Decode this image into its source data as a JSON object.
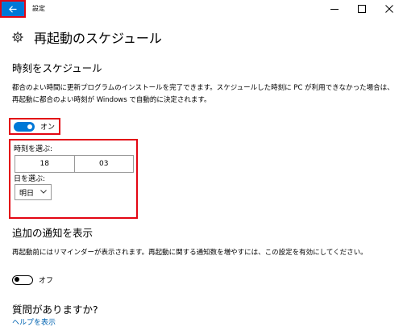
{
  "titlebar": {
    "app_title": "設定",
    "back_icon": "back-arrow-icon",
    "controls": [
      "minimize-icon",
      "maximize-icon",
      "close-icon"
    ]
  },
  "page": {
    "title": "再起動のスケジュール",
    "icon": "gear-icon"
  },
  "schedule": {
    "section_title": "時刻をスケジュール",
    "description": "都合のよい時間に更新プログラムのインストールを完了できます。スケジュールした時刻に PC が利用できなかった場合は、再起動に都合のよい時刻が Windows で自動的に決定されます。",
    "toggle_state": "on",
    "toggle_label": "オン",
    "time_label": "時刻を選ぶ:",
    "hour": "18",
    "minute": "03",
    "day_label": "日を選ぶ:",
    "day_value": "明日"
  },
  "notifications": {
    "section_title": "追加の通知を表示",
    "description": "再起動前にはリマインダーが表示されます。再起動に関する通知数を増やすには、この設定を有効にしてください。",
    "toggle_state": "off",
    "toggle_label": "オフ"
  },
  "help": {
    "section_title": "質問がありますか?",
    "link_text": "ヘルプを表示"
  },
  "colors": {
    "accent": "#0078d7",
    "highlight": "#e30613",
    "link": "#0063b1"
  }
}
